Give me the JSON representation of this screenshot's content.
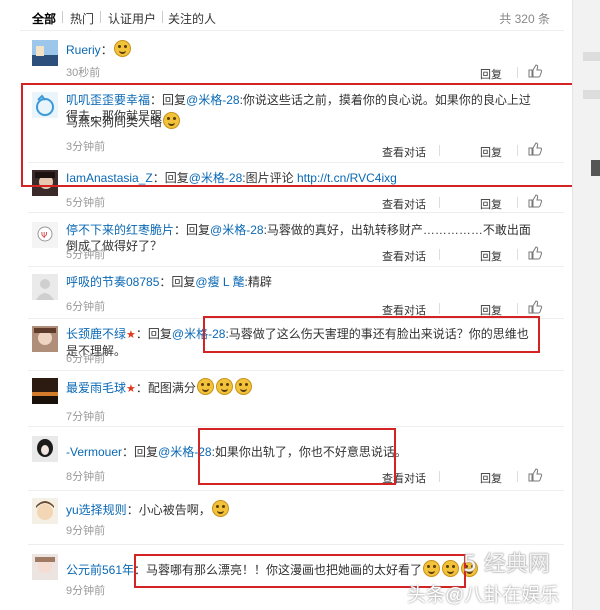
{
  "tabs": [
    "全部",
    "热门",
    "认证用户",
    "关注的人"
  ],
  "total_count": "共 320 条",
  "actions": {
    "reply": "回复",
    "view_conversation": "查看对话"
  },
  "comments": [
    {
      "user": "Rueriy",
      "sep": "：",
      "text": "",
      "time": "30秒前"
    },
    {
      "user": "叽叽歪歪要幸福",
      "sep": "：",
      "reply_prefix": "回复",
      "at": "@米格-28",
      "text1": ":你说这些话之前，摸着你的良心说。如果你的良心上过得去，那你就是跟",
      "text2": "马燕宋狗同类人咯",
      "time": "3分钟前"
    },
    {
      "user": "IamAnastasia_Z",
      "sep": "：",
      "reply_prefix": "回复",
      "at": "@米格-28",
      "text": ":图片评论 ",
      "link": "http://t.cn/RVC4ixg",
      "time": "5分钟前"
    },
    {
      "user": "停不下来的红枣脆片",
      "sep": "：",
      "reply_prefix": "回复",
      "at": "@米格-28",
      "text": ":马蓉做的真好，出轨转移财产……………不敢出面倒成了做得好了？",
      "time": "5分钟前"
    },
    {
      "user": "呼吸的节奏08785",
      "sep": "：",
      "reply_prefix": "回复",
      "at": "@瘦 L 氂",
      "text": ":精辟",
      "time": "6分钟前"
    },
    {
      "user": "长颈鹿不绿",
      "sep": "：",
      "reply_prefix": "回复",
      "at": "@米格-28",
      "text": ":马蓉做了这么伤天害理的事还有脸出来说话？你的思维也是不理解。",
      "time": "6分钟前"
    },
    {
      "user": "最爱雨毛球",
      "sep": "：",
      "text": "配图满分",
      "time": "7分钟前"
    },
    {
      "user": "-Vermouer",
      "sep": "：",
      "reply_prefix": "回复",
      "at": "@米格-28",
      "text": ":如果你出轨了，你也不好意思说话。",
      "time": "8分钟前"
    },
    {
      "user": "yu选择规则",
      "sep": "：",
      "text": "小心被告啊，",
      "time": "9分钟前"
    },
    {
      "user": "公元前561年",
      "sep": "：",
      "text": "马蓉哪有那么漂亮！！你这漫画也把她画的太好看了",
      "time": "9分钟前"
    }
  ],
  "watermark": {
    "site": "5 经典网",
    "text": "头条@八卦在娱乐"
  },
  "colors": {
    "link": "#0a68b4",
    "highlight": "#d42323"
  }
}
